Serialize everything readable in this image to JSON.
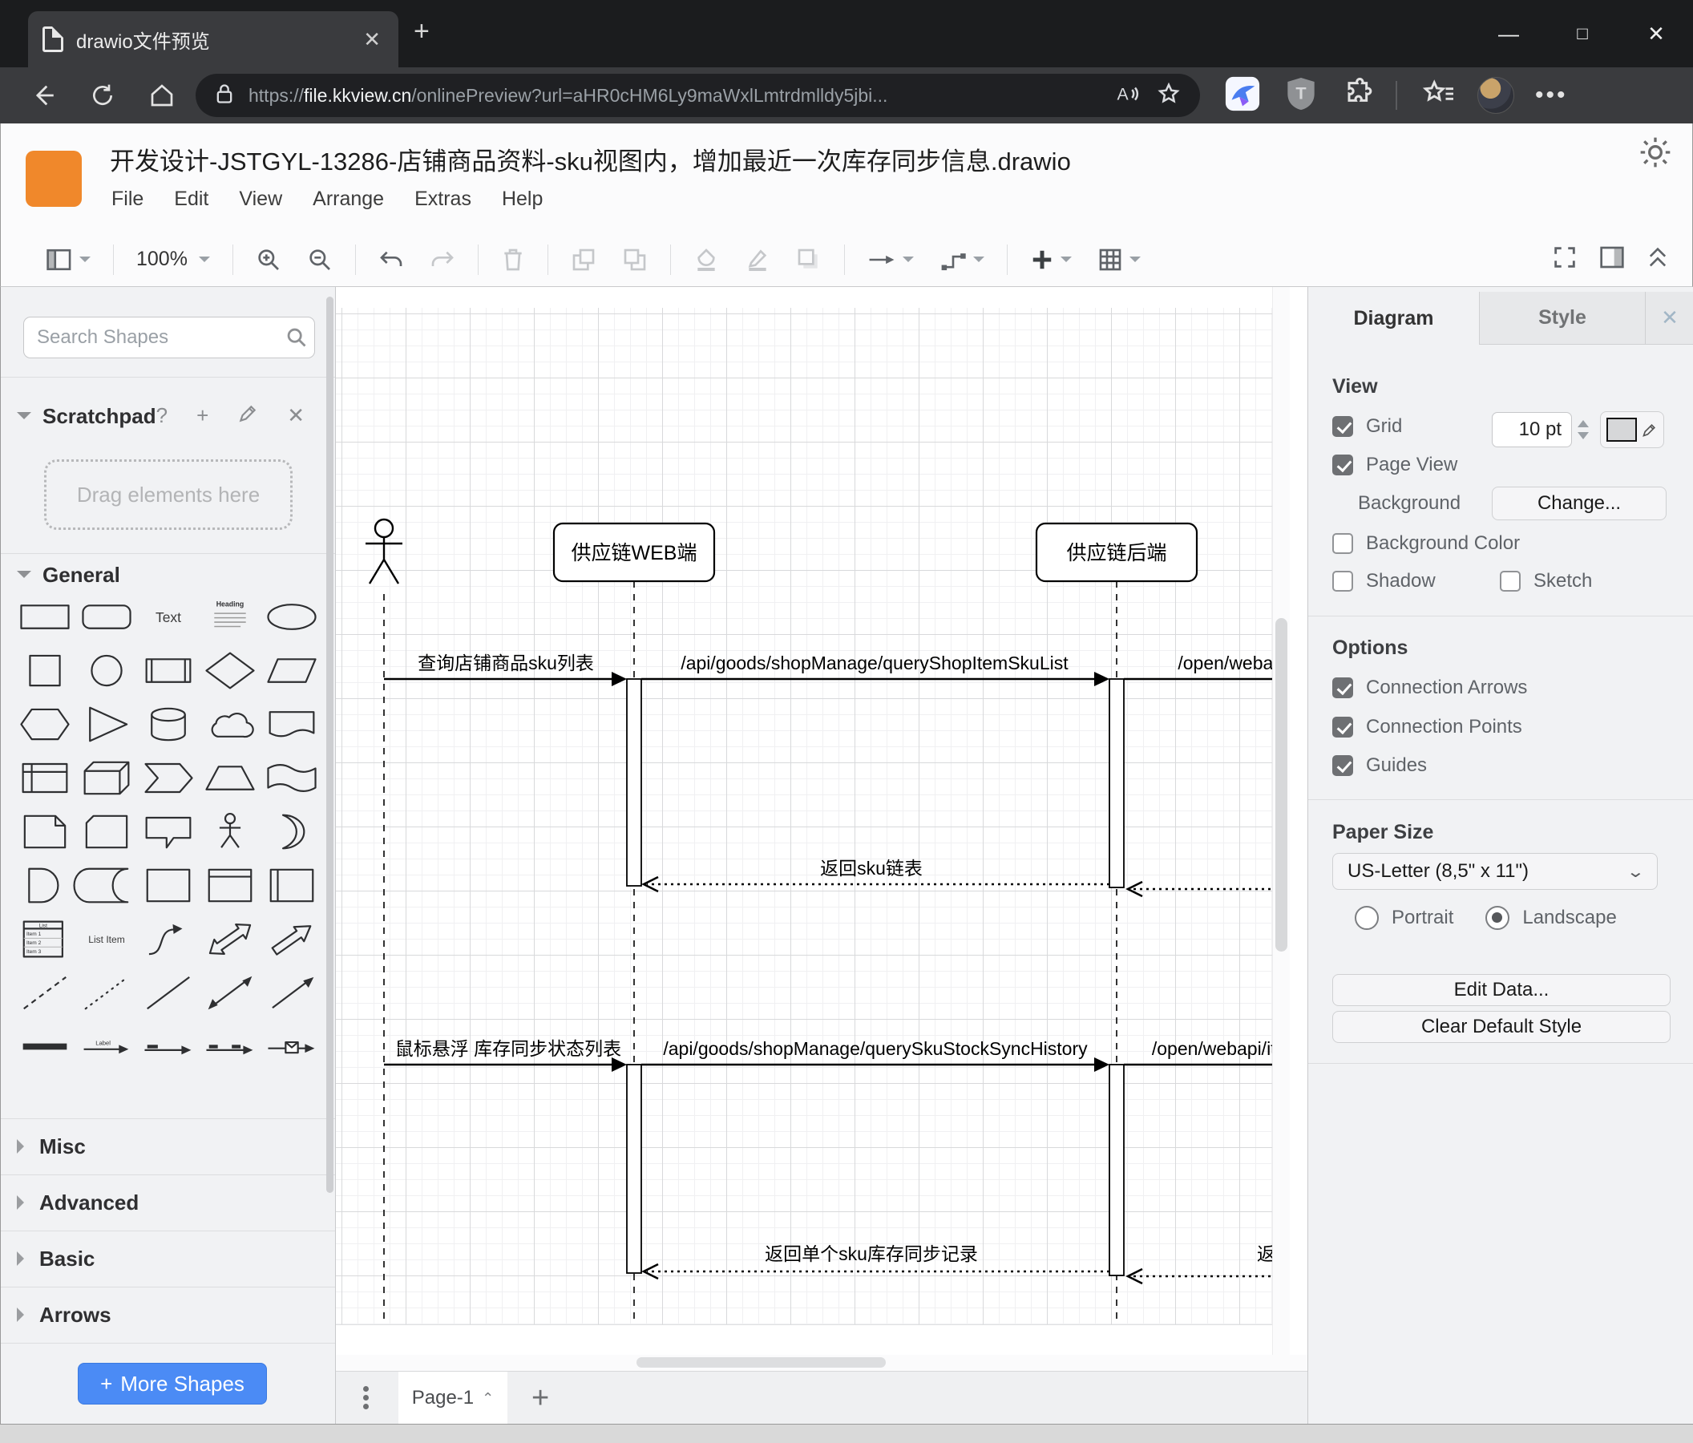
{
  "browser": {
    "tab_title": "drawio文件预览",
    "url_scheme": "https://",
    "url_host": "file.kkview.cn",
    "url_rest": "/onlinePreview?url=aHR0cHM6Ly9maWxlLmtrdmlldy5jbi...",
    "window_controls": [
      "minimize",
      "maximize",
      "close"
    ],
    "toolbar_icons": [
      "back",
      "refresh",
      "home",
      "lock",
      "read-aloud",
      "bookmark-star",
      "extension-bird",
      "shield-t",
      "puzzle-extensions",
      "favorites-list",
      "avatar",
      "more-menu"
    ]
  },
  "app": {
    "logo_color": "#F0882B",
    "title": "开发设计-JSTGYL-13286-店铺商品资料-sku视图内，增加最近一次库存同步信息.drawio",
    "menu": [
      "File",
      "Edit",
      "View",
      "Arrange",
      "Extras",
      "Help"
    ],
    "theme_icon": "sun-icon"
  },
  "toolbar": {
    "zoom_level": "100%",
    "groups": [
      {
        "items": [
          {
            "icon": "view-panel",
            "caret": true,
            "enabled": true
          }
        ]
      },
      {
        "items": [
          {
            "icon": "zoom-level",
            "caret": true,
            "enabled": true,
            "text": true
          }
        ]
      },
      {
        "items": [
          {
            "icon": "zoom-in",
            "enabled": true
          },
          {
            "icon": "zoom-out",
            "enabled": true
          }
        ]
      },
      {
        "items": [
          {
            "icon": "undo",
            "enabled": true
          },
          {
            "icon": "redo",
            "enabled": false
          }
        ]
      },
      {
        "items": [
          {
            "icon": "delete",
            "enabled": false
          }
        ]
      },
      {
        "items": [
          {
            "icon": "to-front",
            "enabled": false
          },
          {
            "icon": "to-back",
            "enabled": false
          }
        ]
      },
      {
        "items": [
          {
            "icon": "fill-color",
            "enabled": false
          },
          {
            "icon": "line-color",
            "enabled": false
          },
          {
            "icon": "shadow",
            "enabled": false
          }
        ]
      },
      {
        "items": [
          {
            "icon": "connection",
            "caret": true,
            "enabled": true
          },
          {
            "icon": "waypoints",
            "caret": true,
            "enabled": true
          }
        ]
      },
      {
        "items": [
          {
            "icon": "insert",
            "caret": true,
            "enabled": true
          },
          {
            "icon": "table",
            "caret": true,
            "enabled": true
          }
        ]
      }
    ],
    "right_icons": [
      "fullscreen",
      "format-panel",
      "collapse"
    ]
  },
  "sidebar": {
    "search_placeholder": "Search Shapes",
    "scratchpad_title": "Scratchpad",
    "scratchpad_hint": "Drag elements here",
    "general_label": "General",
    "collapsed_sections": [
      "Misc",
      "Advanced",
      "Basic",
      "Arrows"
    ],
    "more_shapes_label": "More Shapes",
    "shapes": [
      "rectangle",
      "rounded-rectangle",
      "text",
      "textbox",
      "ellipse",
      "square",
      "circle",
      "process",
      "diamond",
      "parallelogram",
      "hexagon",
      "triangle",
      "cylinder",
      "cloud",
      "document",
      "internal-storage",
      "cube",
      "step",
      "trapezoid",
      "tape",
      "note",
      "card",
      "callout",
      "actor",
      "or",
      "and",
      "data-storage",
      "container",
      "vertical-container",
      "horizontal-container",
      "list",
      "list-item",
      "curve",
      "bidirectional-arrow",
      "arrow",
      "dashed-line",
      "dotted-line",
      "line",
      "bidirectional-connector",
      "directional-connector",
      "link",
      "labeled-arrow",
      "source-target-arrow",
      "source-target-arrow-2",
      "annotated-link"
    ],
    "shape_texts": {
      "text": "Text",
      "heading": "Heading",
      "list": "List",
      "item1": "Item 1",
      "item2": "Item 2",
      "item3": "Item 3",
      "list_item": "List Item",
      "label": "Label"
    }
  },
  "diagram": {
    "lifelines": [
      {
        "label": "供应链WEB端"
      },
      {
        "label": "供应链后端"
      }
    ],
    "messages": {
      "m1": "查询店铺商品sku列表",
      "m1_api": "/api/goods/shopManage/queryShopItemSkuList",
      "m1_open": "/open/webapi/",
      "r1": "返回sku链表",
      "m2": "鼠标悬浮 库存同步状态列表",
      "m2_api": "/api/goods/shopManage/querySkuStockSyncHistory",
      "m2_open": "/open/webapi/iten",
      "r2": "返回单个sku库存同步记录",
      "r2_right": "返回"
    }
  },
  "panel": {
    "tabs": {
      "diagram": "Diagram",
      "style": "Style"
    },
    "view": {
      "heading": "View",
      "grid_label": "Grid",
      "grid_checked": true,
      "grid_size": "10 pt",
      "page_view_label": "Page View",
      "page_view_checked": true,
      "background_label": "Background",
      "change_label": "Change...",
      "background_color_label": "Background Color",
      "background_color_checked": false,
      "shadow_label": "Shadow",
      "shadow_checked": false,
      "sketch_label": "Sketch",
      "sketch_checked": false
    },
    "options": {
      "heading": "Options",
      "items": [
        {
          "label": "Connection Arrows",
          "checked": true
        },
        {
          "label": "Connection Points",
          "checked": true
        },
        {
          "label": "Guides",
          "checked": true
        }
      ]
    },
    "paper": {
      "heading": "Paper Size",
      "size": "US-Letter (8,5\" x 11\")",
      "portrait": "Portrait",
      "portrait_selected": false,
      "landscape": "Landscape",
      "landscape_selected": true
    },
    "buttons": {
      "edit_data": "Edit Data...",
      "clear_default_style": "Clear Default Style"
    }
  },
  "footer": {
    "page_tab": "Page-1"
  }
}
